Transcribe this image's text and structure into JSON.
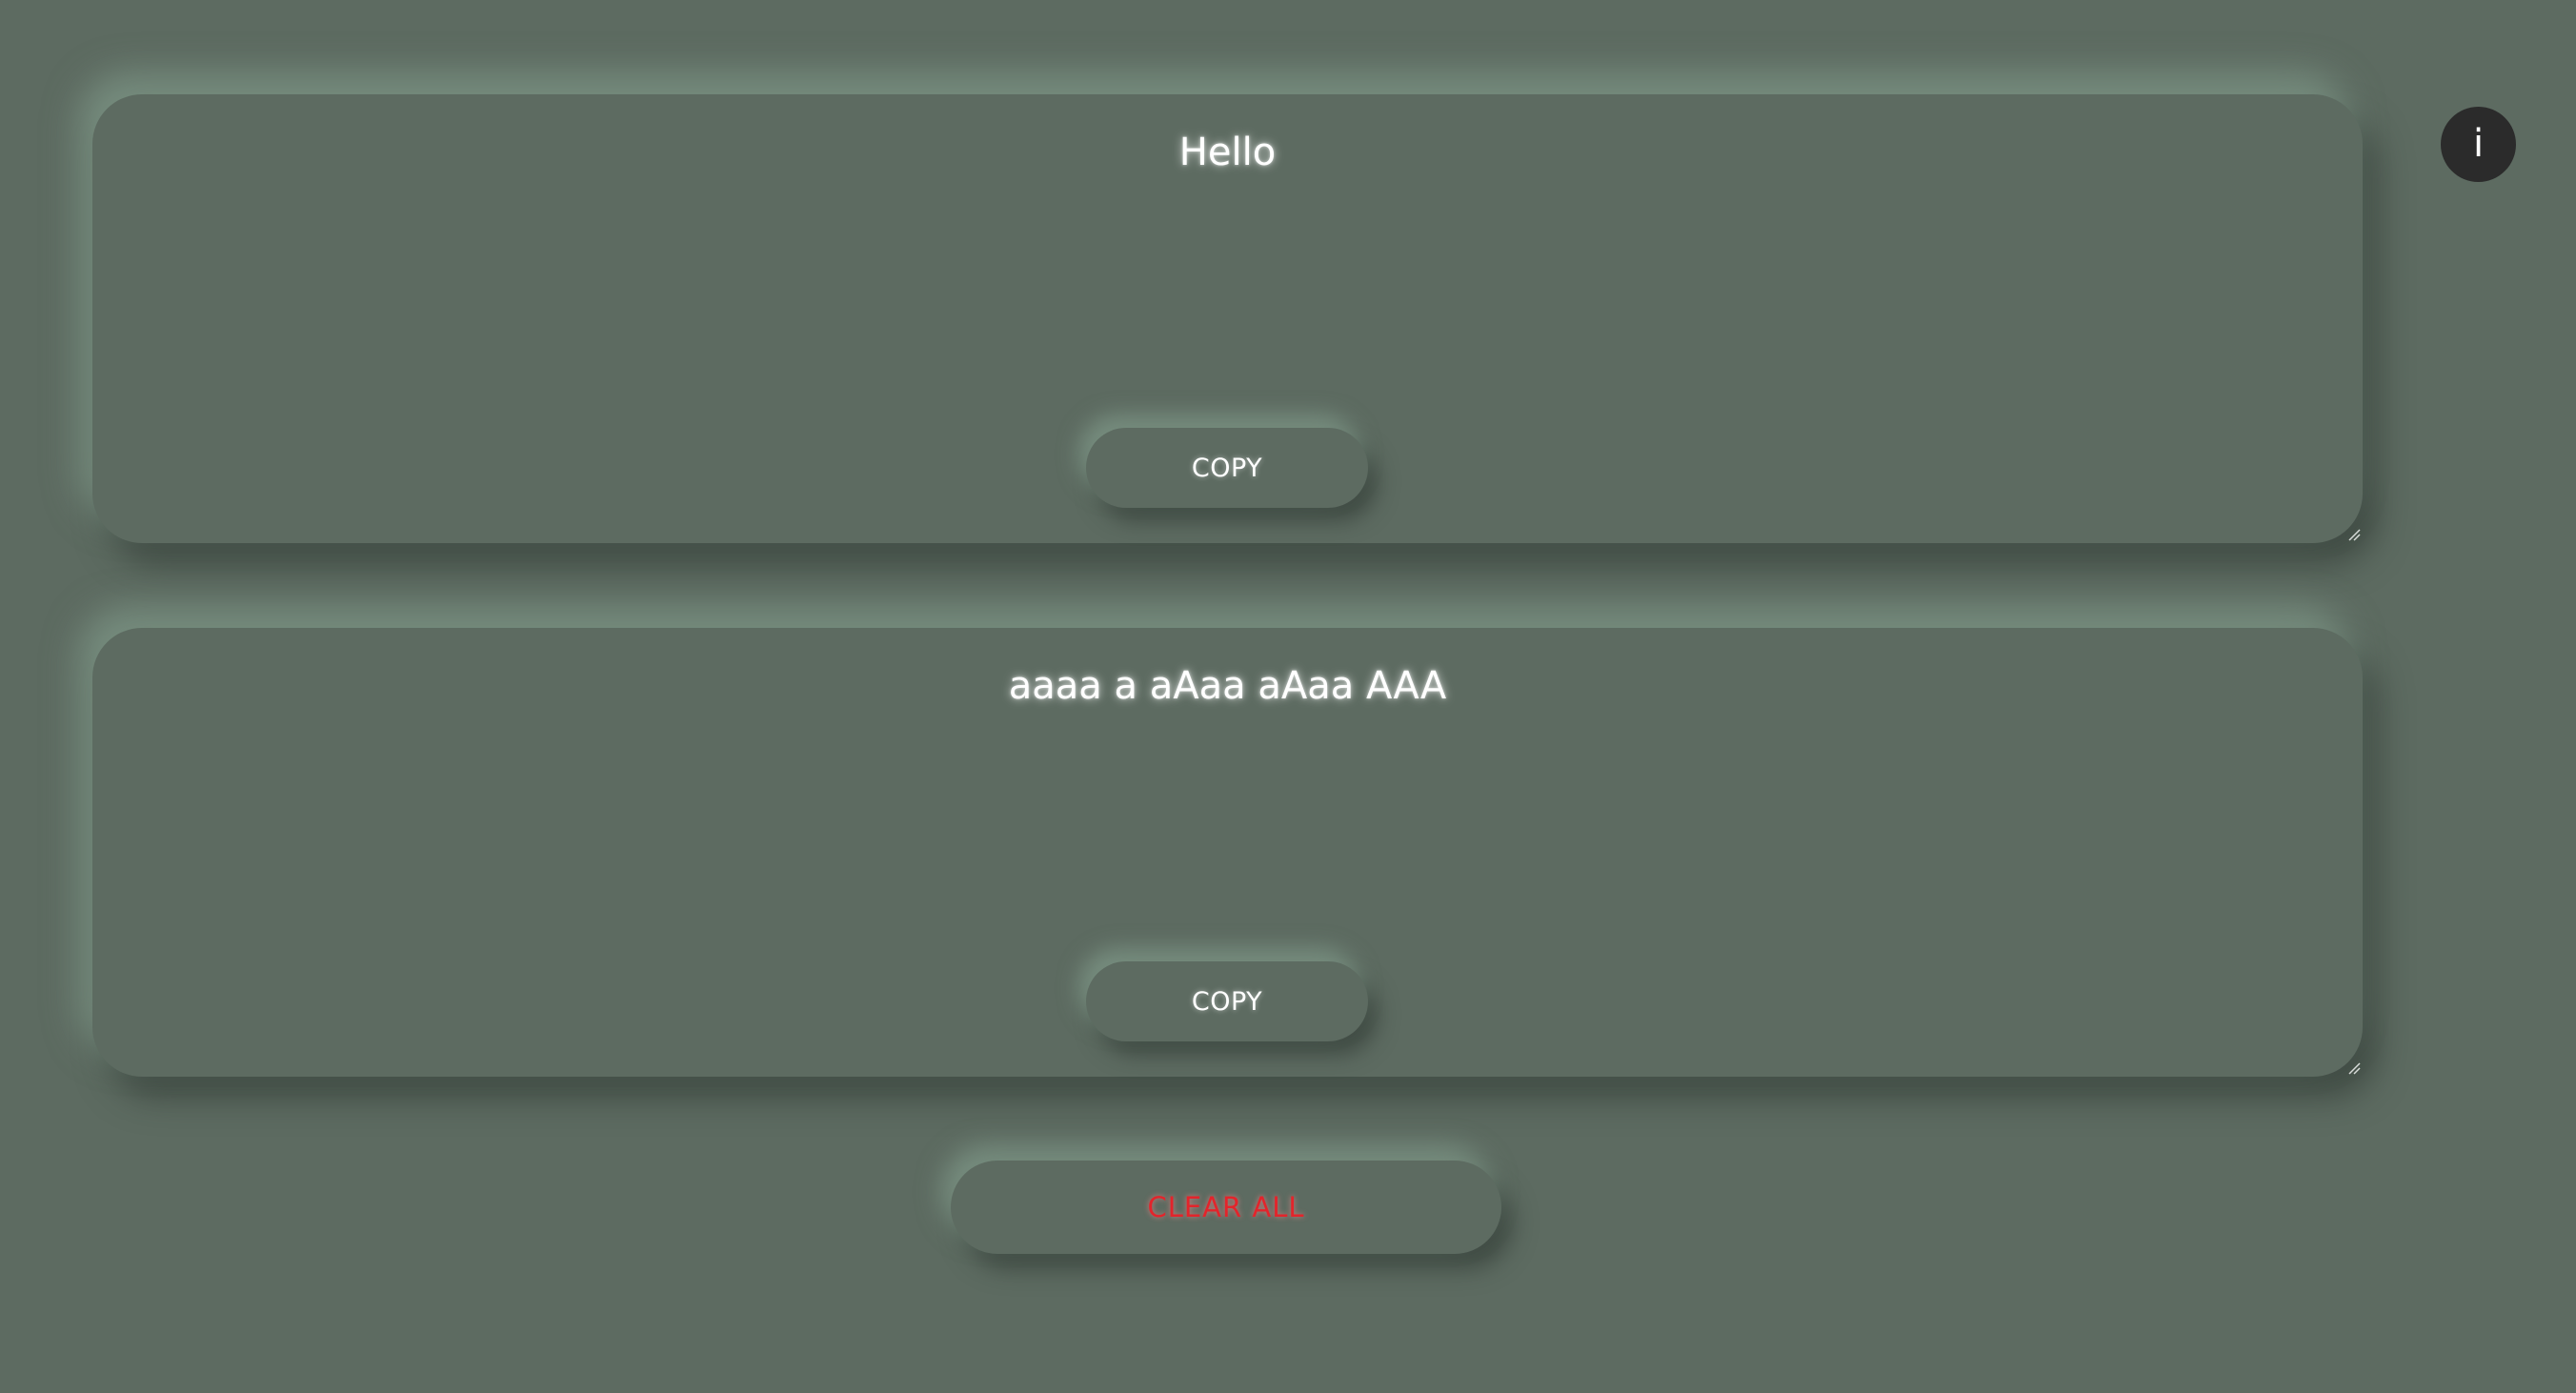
{
  "input_panel": {
    "text": "Hello",
    "copy_label": "COPY"
  },
  "output_panel": {
    "text": "aaaa a aAaa aAaa AAA",
    "copy_label": "COPY"
  },
  "clear_all_label": "CLEAR ALL",
  "info_button_label": "i",
  "colors": {
    "background": "#5d6b61",
    "text": "#ffffff",
    "clear_text": "#e3242b",
    "info_bg": "#2b2b2b"
  }
}
